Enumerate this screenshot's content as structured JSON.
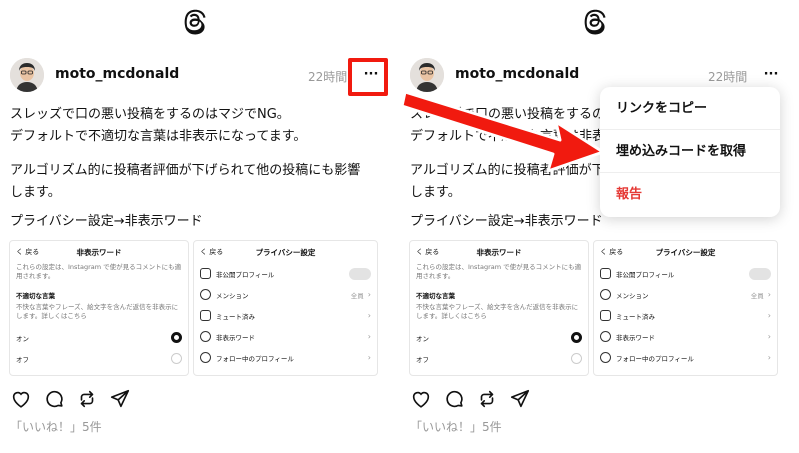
{
  "post": {
    "username": "moto_mcdonald",
    "time": "22時間",
    "more": "···",
    "text1": "スレッズで口の悪い投稿をするのはマジでNG。\nデフォルトで不適切な言葉は非表示になってます。",
    "text2": "アルゴリズム的に投稿者評価が下げられて他の投稿にも影響\nします。",
    "text3": "プライバシー設定→非表示ワード",
    "likes": "「いいね！」5件"
  },
  "shot1": {
    "back": "く 戻る",
    "title": "非表示ワード",
    "desc": "これらの設定は、Instagram で使が見るコメントにも適用されます。",
    "heading": "不適切な言葉",
    "heading_desc": "不快な言葉やフレーズ、絵文字を含んだ返信を非表示にします。詳しくはこちら",
    "on": "オン",
    "off": "オフ"
  },
  "shot2": {
    "back": "く 戻る",
    "title": "プライバシー設定",
    "items": [
      {
        "label": "非公開プロフィール",
        "value": ""
      },
      {
        "label": "メンション",
        "value": "全員"
      },
      {
        "label": "ミュート済み",
        "value": ""
      },
      {
        "label": "非表示ワード",
        "value": ""
      },
      {
        "label": "フォロー中のプロフィール",
        "value": ""
      }
    ]
  },
  "menu": {
    "copy_link": "リンクをコピー",
    "embed": "埋め込みコードを取得",
    "report": "報告"
  },
  "colors": {
    "highlight": "#f11a0f",
    "report": "#e53935"
  }
}
